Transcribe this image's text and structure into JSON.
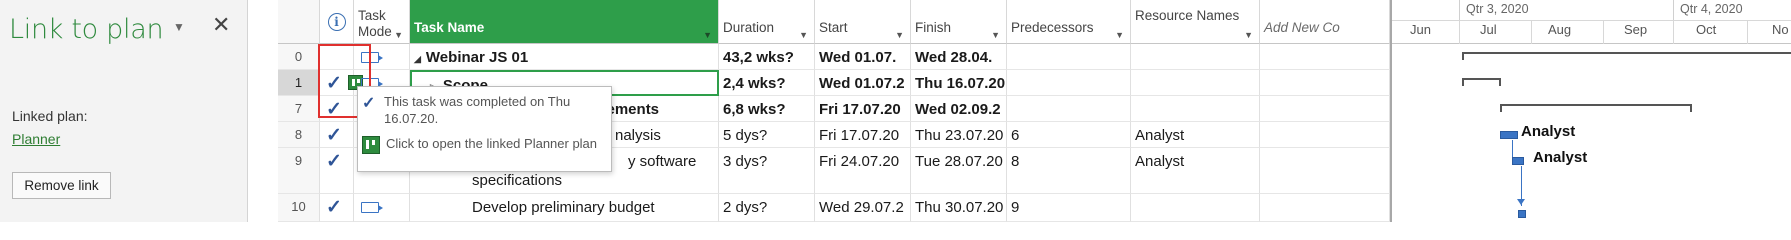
{
  "pane": {
    "title": "Link to plan",
    "menu_glyph": "▼",
    "close_glyph": "✕",
    "linked_plan_label": "Linked plan:",
    "linked_plan_link": "Planner",
    "remove_button": "Remove link"
  },
  "grid": {
    "headers": {
      "indicators": "i",
      "task_mode": "Task Mode",
      "task_name": "Task Name",
      "duration": "Duration",
      "start": "Start",
      "finish": "Finish",
      "predecessors": "Predecessors",
      "resource_names": "Resource Names",
      "add_new": "Add New Co"
    },
    "rows": [
      {
        "id": "0",
        "name": "Webinar JS 01",
        "duration": "43,2 wks?",
        "start": "Wed 01.07.",
        "finish": "Wed 28.04.",
        "predecessors": "",
        "resources": ""
      },
      {
        "id": "1",
        "name": "Scope",
        "duration": "2,4 wks?",
        "start": "Wed 01.07.2",
        "finish": "Thu 16.07.20",
        "predecessors": "",
        "resources": ""
      },
      {
        "id": "7",
        "name": "Requirements",
        "duration": "6,8 wks?",
        "start": "Fri 17.07.20",
        "finish": "Wed 02.09.2",
        "predecessors": "",
        "resources": ""
      },
      {
        "id": "8",
        "name": "nalysis",
        "duration": "5 dys?",
        "start": "Fri 17.07.20",
        "finish": "Thu 23.07.20",
        "predecessors": "6",
        "resources": "Analyst"
      },
      {
        "id": "9",
        "name_line1": "y software",
        "name_line2": "specifications",
        "duration": "3 dys?",
        "start": "Fri 24.07.20",
        "finish": "Tue 28.07.20",
        "predecessors": "8",
        "resources": "Analyst"
      },
      {
        "id": "10",
        "name": "Develop preliminary budget",
        "duration": "2 dys?",
        "start": "Wed 29.07.2",
        "finish": "Thu 30.07.20",
        "predecessors": "9",
        "resources": ""
      }
    ]
  },
  "tooltip": {
    "completed": "This task was completed on Thu 16.07.20.",
    "open_planner": "Click to open the linked Planner plan"
  },
  "timeline": {
    "quarters": [
      "Qtr 3, 2020",
      "Qtr 4, 2020"
    ],
    "months": [
      "Jun",
      "Jul",
      "Aug",
      "Sep",
      "Oct",
      "No"
    ],
    "bar_labels": [
      "Analyst",
      "Analyst"
    ]
  },
  "colors": {
    "accent_green": "#2e9e4a",
    "title_green": "#2f8a3e",
    "check_blue": "#2f5597",
    "highlight_red": "#e0302e"
  }
}
